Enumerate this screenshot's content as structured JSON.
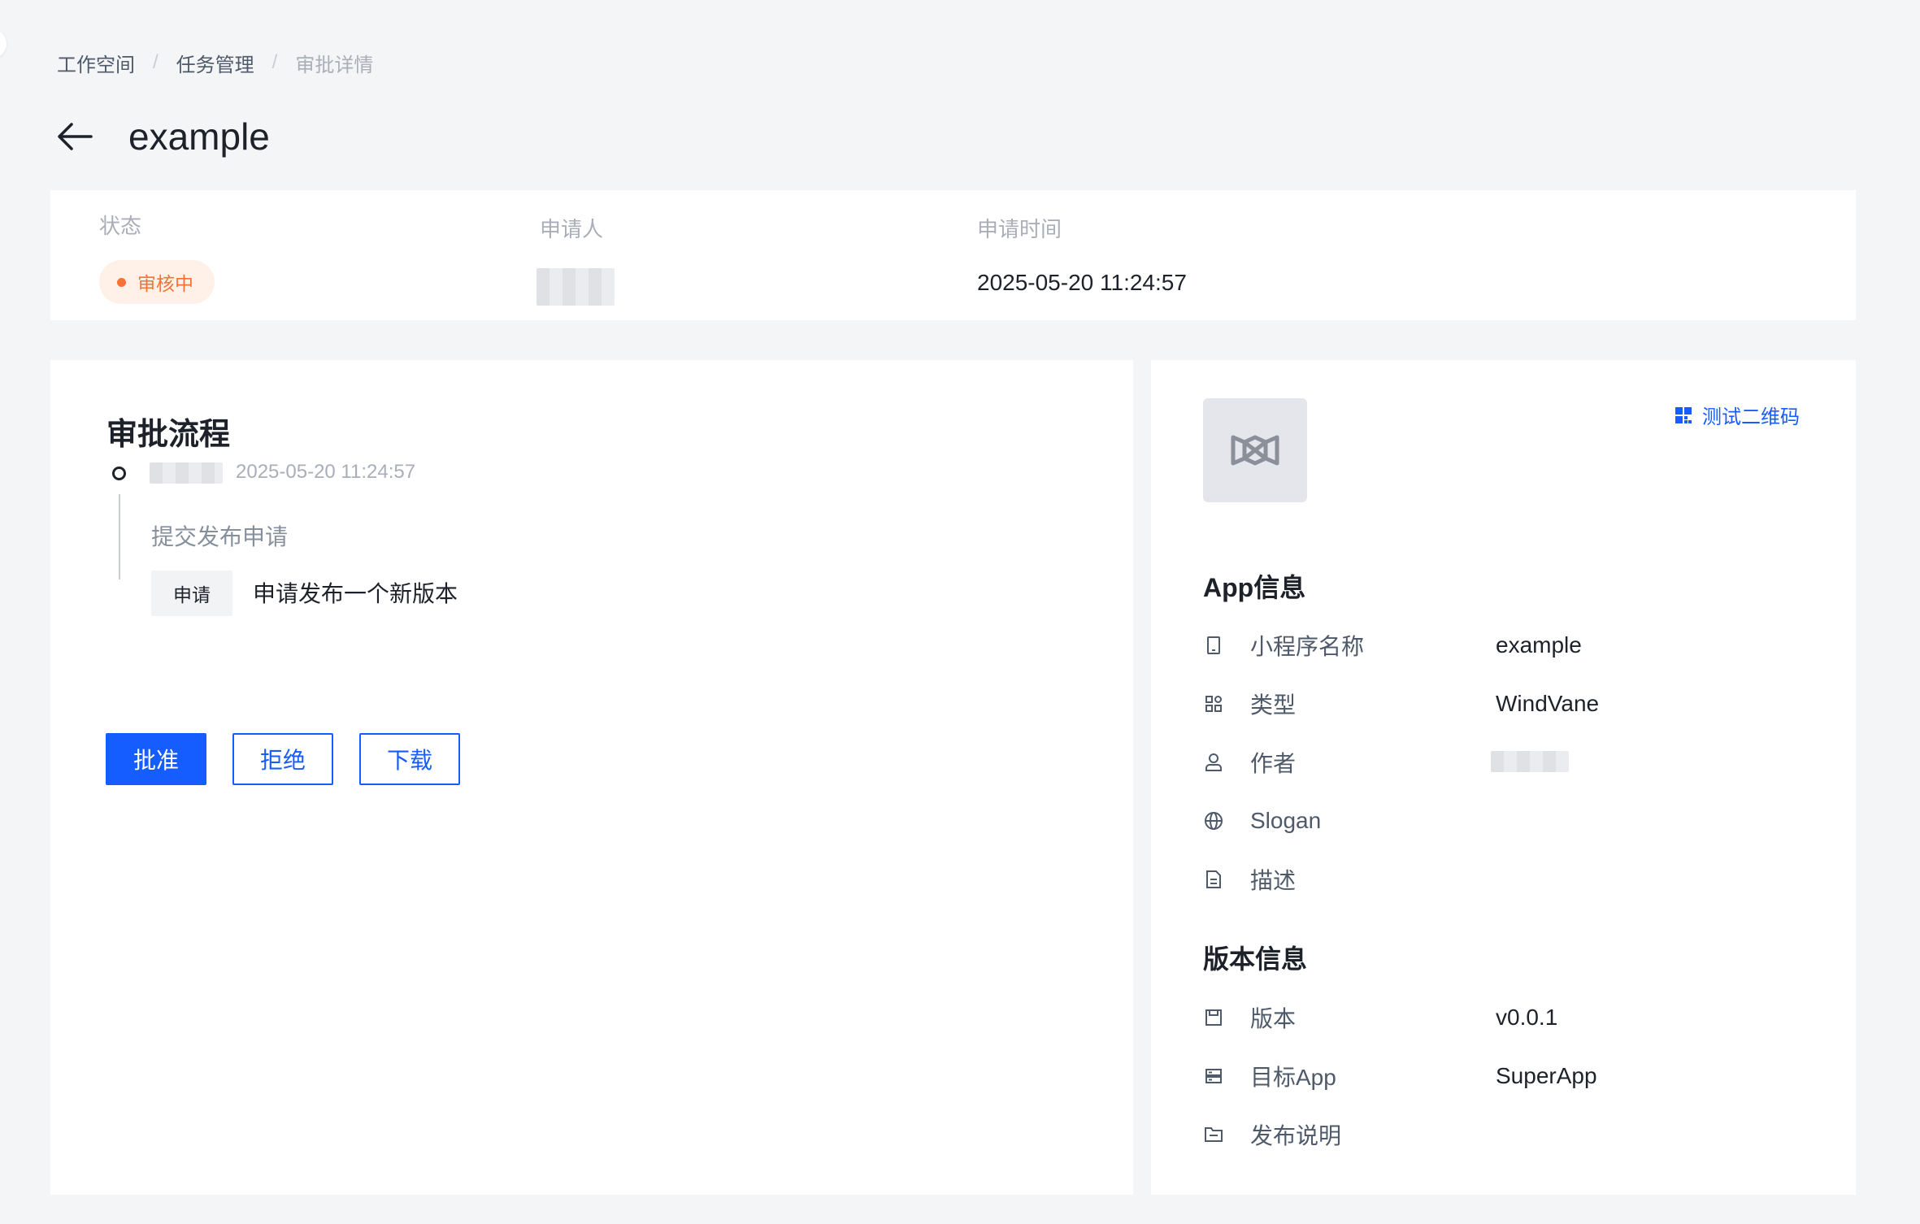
{
  "breadcrumb": {
    "items": [
      "工作空间",
      "任务管理",
      "审批详情"
    ],
    "separator": "/"
  },
  "header": {
    "back_icon": "arrow-left-icon",
    "title": "example"
  },
  "summary": {
    "status_label": "状态",
    "status_value": "审核中",
    "applicant_label": "申请人",
    "time_label": "申请时间",
    "time_value": "2025-05-20 11:24:57"
  },
  "approval": {
    "title": "审批流程",
    "step": {
      "time": "2025-05-20 11:24:57",
      "action": "提交发布申请",
      "tag": "申请",
      "description": "申请发布一个新版本"
    },
    "buttons": {
      "approve": "批准",
      "reject": "拒绝",
      "download": "下载"
    }
  },
  "app_panel": {
    "logo_icon": "app-logo-icon",
    "qr_label": "测试二维码",
    "app_info_title": "App信息",
    "app_info": [
      {
        "icon": "phone-icon",
        "label": "小程序名称",
        "value": "example"
      },
      {
        "icon": "apps-icon",
        "label": "类型",
        "value": "WindVane"
      },
      {
        "icon": "user-icon",
        "label": "作者",
        "value": ""
      },
      {
        "icon": "globe-icon",
        "label": "Slogan",
        "value": ""
      },
      {
        "icon": "file-icon",
        "label": "描述",
        "value": ""
      }
    ],
    "version_info_title": "版本信息",
    "version_info": [
      {
        "icon": "save-icon",
        "label": "版本",
        "value": "v0.0.1"
      },
      {
        "icon": "storage-icon",
        "label": "目标App",
        "value": "SuperApp"
      },
      {
        "icon": "folder-icon",
        "label": "发布说明",
        "value": ""
      }
    ]
  },
  "colors": {
    "primary": "#165dff",
    "status_warning": "#f77234",
    "page_bg": "#f4f5f7"
  }
}
